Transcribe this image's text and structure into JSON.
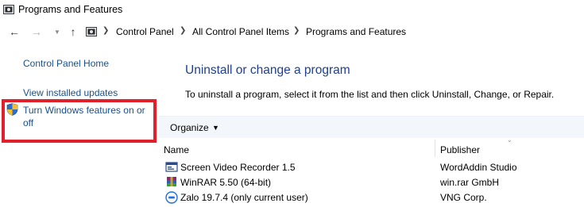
{
  "window": {
    "title": "Programs and Features"
  },
  "address_bar": {
    "crumbs": [
      "Control Panel",
      "All Control Panel Items",
      "Programs and Features"
    ]
  },
  "sidebar": {
    "links": [
      {
        "label": "Control Panel Home"
      },
      {
        "label": "View installed updates"
      },
      {
        "label": "Turn Windows features on or off"
      }
    ]
  },
  "main": {
    "heading": "Uninstall or change a program",
    "description": "To uninstall a program, select it from the list and then click Uninstall, Change, or Repair.",
    "toolbar": {
      "organize_label": "Organize"
    },
    "columns": {
      "name": "Name",
      "publisher": "Publisher"
    },
    "programs": [
      {
        "name": "Screen Video Recorder 1.5",
        "publisher": "WordAddin Studio",
        "icon": "screen-recorder-icon"
      },
      {
        "name": "WinRAR 5.50 (64-bit)",
        "publisher": "win.rar GmbH",
        "icon": "winrar-icon"
      },
      {
        "name": "Zalo 19.7.4 (only current user)",
        "publisher": "VNG Corp.",
        "icon": "zalo-icon"
      }
    ]
  },
  "colors": {
    "link": "#1a4f8a",
    "heading": "#1e3f8f",
    "highlight": "#e0202a",
    "toolbar_bg": "#f3f6fb"
  }
}
